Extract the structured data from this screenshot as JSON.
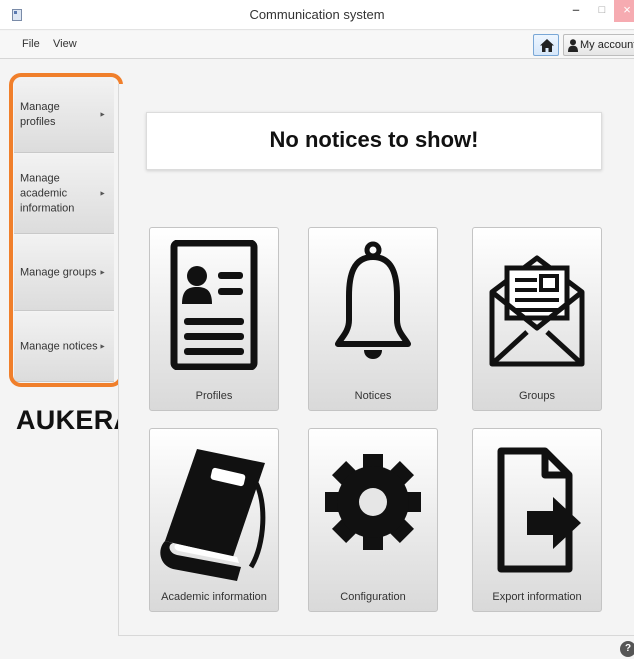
{
  "window": {
    "title": "Communication system",
    "controls": {
      "minimize": "–",
      "maximize": "□",
      "close": "×"
    }
  },
  "menubar": {
    "items": [
      "File",
      "View"
    ],
    "home_icon": "home-icon",
    "account_label": "My account",
    "account_icon": "user-icon"
  },
  "sidebar": {
    "items": [
      {
        "label": "Manage profiles",
        "arrow": "►"
      },
      {
        "label": "Manage academic information",
        "arrow": "►"
      },
      {
        "label": "Manage groups",
        "arrow": "►"
      },
      {
        "label": "Manage notices",
        "arrow": "►"
      }
    ],
    "highlight_color": "#f07f2b"
  },
  "annotation": "AUKERAK!",
  "main": {
    "notice_message": "No notices to show!",
    "tiles": [
      {
        "label": "Profiles",
        "icon": "profile-card-icon"
      },
      {
        "label": "Notices",
        "icon": "bell-icon"
      },
      {
        "label": "Groups",
        "icon": "envelope-icon"
      },
      {
        "label": "Academic information",
        "icon": "book-icon"
      },
      {
        "label": "Configuration",
        "icon": "gear-icon"
      },
      {
        "label": "Export information",
        "icon": "export-file-icon"
      }
    ]
  },
  "help_glyph": "?"
}
